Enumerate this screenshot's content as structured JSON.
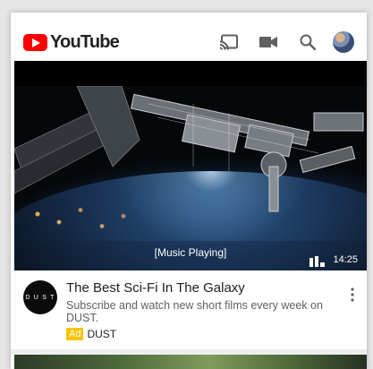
{
  "header": {
    "logo_text": "YouTube",
    "icons": [
      "cast-icon",
      "camera-icon",
      "search-icon",
      "account-avatar"
    ]
  },
  "video": {
    "caption": "[Music Playing]",
    "duration": "14:25"
  },
  "ad": {
    "channel_avatar_text": "D U S T",
    "title": "The Best Sci-Fi In The Galaxy",
    "description": "Subscribe and watch new short films every week on DUST.",
    "badge": "Ad",
    "channel": "DUST"
  },
  "colors": {
    "brand_red": "#ff0000",
    "ad_badge": "#f9c400",
    "title_text": "#212121",
    "secondary_text": "#606060"
  }
}
